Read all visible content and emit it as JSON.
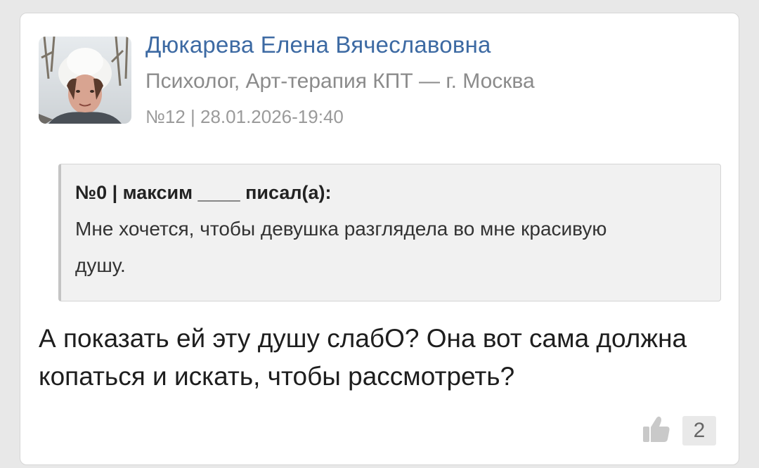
{
  "post": {
    "author": {
      "name": "Дюкарева Елена Вячеславовна",
      "role": "Психолог, Арт-терапия КПТ — г. Москва",
      "avatar_icon": "user-avatar-photo"
    },
    "meta": "№12 | 28.01.2026-19:40",
    "quote": {
      "header": "№0 | максим ____ писал(а):",
      "text": "Мне хочется, чтобы девушка разглядела во мне красивую душу."
    },
    "body": "А показать ей эту душу слабО? Она вот сама должна копаться и искать, чтобы рассмотреть?",
    "likes": {
      "icon": "thumbs-up-icon",
      "count": "2"
    }
  },
  "colors": {
    "author_name": "#3d6aa3",
    "muted_text": "#8b8b8b",
    "quote_bg": "#f1f1f1",
    "page_bg": "#e8e8e8"
  }
}
